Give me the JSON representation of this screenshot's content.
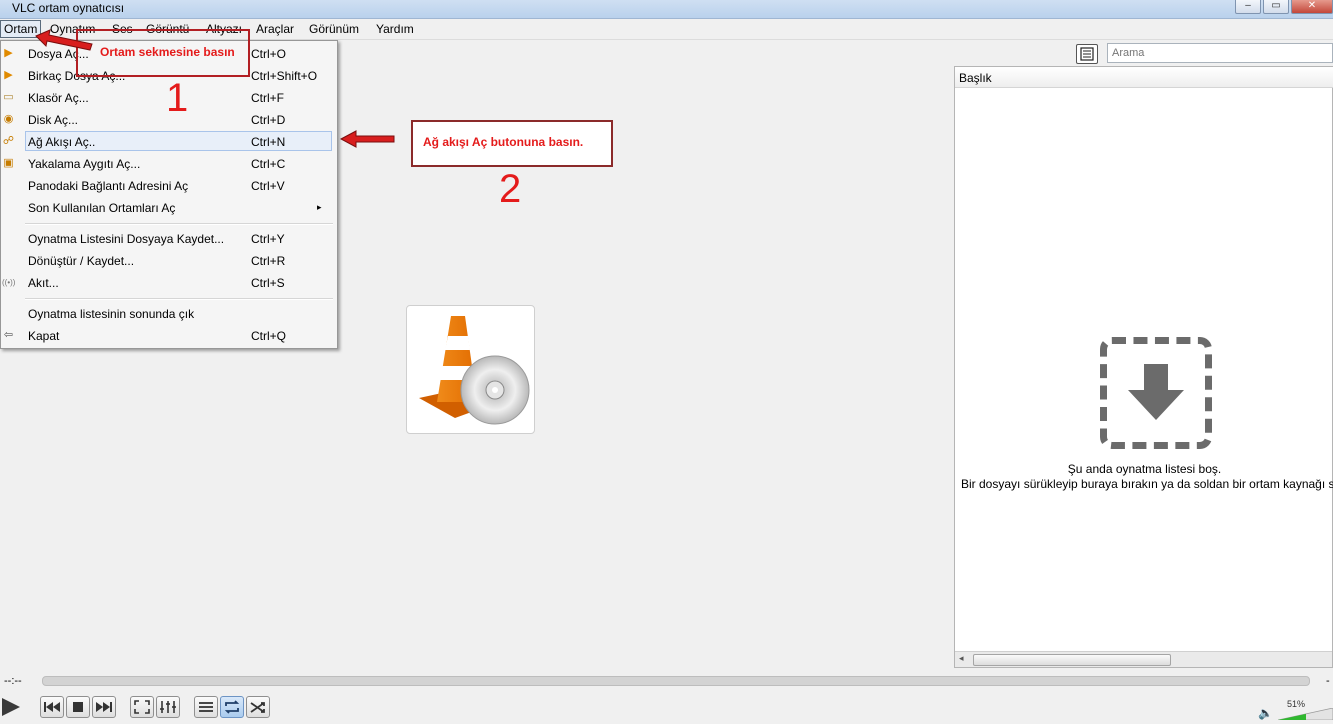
{
  "window": {
    "title": "VLC ortam oynatıcısı",
    "buttons": [
      "–",
      "▭",
      "✕"
    ]
  },
  "menubar": [
    "Ortam",
    "Oynatım",
    "Ses",
    "Görüntü",
    "Altyazı",
    "Araçlar",
    "Görünüm",
    "Yardım"
  ],
  "media_menu": {
    "items": [
      {
        "label": "Dosya Aç...",
        "shortcut": "Ctrl+O",
        "icon": "file-icon"
      },
      {
        "label": "Birkaç Dosya Aç...",
        "shortcut": "Ctrl+Shift+O",
        "icon": "files-icon"
      },
      {
        "label": "Klasör Aç...",
        "shortcut": "Ctrl+F",
        "icon": "folder-icon"
      },
      {
        "label": "Disk Aç...",
        "shortcut": "Ctrl+D",
        "icon": "disc-icon"
      },
      {
        "label": "Ağ Akışı Aç..",
        "shortcut": "Ctrl+N",
        "icon": "network-icon"
      },
      {
        "label": "Yakalama Aygıtı Aç...",
        "shortcut": "Ctrl+C",
        "icon": "capture-icon"
      },
      {
        "label": "Panodaki Bağlantı Adresini Aç",
        "shortcut": "Ctrl+V",
        "icon": ""
      },
      {
        "label": "Son Kullanılan Ortamları Aç",
        "shortcut": "▸",
        "icon": ""
      },
      {
        "label": "Oynatma Listesini Dosyaya Kaydet...",
        "shortcut": "Ctrl+Y",
        "icon": ""
      },
      {
        "label": "Dönüştür / Kaydet...",
        "shortcut": "Ctrl+R",
        "icon": ""
      },
      {
        "label": "Akıt...",
        "shortcut": "Ctrl+S",
        "icon": "stream-icon"
      },
      {
        "label": "Oynatma listesinin sonunda çık",
        "shortcut": "",
        "icon": ""
      },
      {
        "label": "Kapat",
        "shortcut": "Ctrl+Q",
        "icon": "exit-icon"
      }
    ]
  },
  "annotations": {
    "step1_text": "Ortam sekmesine basın",
    "step1_number": "1",
    "step2_text": "Ağ akışı Aç butonuna basın.",
    "step2_number": "2"
  },
  "playlist": {
    "search_placeholder": "Arama",
    "column_header": "Başlık",
    "empty_line1": "Şu anda oynatma listesi boş.",
    "empty_line2": "Bir dosyayı sürükleyip buraya bırakın ya da soldan bir ortam kaynağı seçin."
  },
  "controls": {
    "time_elapsed": "--:--",
    "time_total": "-",
    "volume": "51%"
  },
  "colors": {
    "annotation": "#e41b1b",
    "accent_blue": "#6d94c4"
  }
}
